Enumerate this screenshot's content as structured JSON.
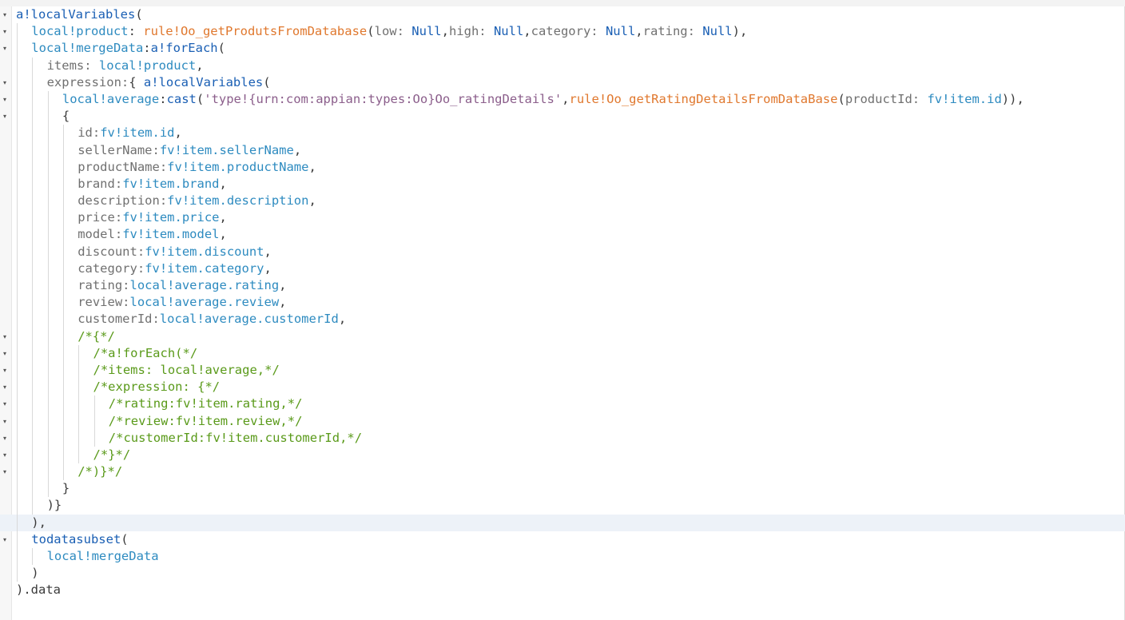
{
  "editor": {
    "highlighted_line": 31,
    "lines": [
      {
        "fold": true,
        "indent": 0,
        "tokens": [
          {
            "t": "a!localVariables",
            "c": "kw"
          },
          {
            "t": "(",
            "c": "plain"
          }
        ]
      },
      {
        "fold": true,
        "indent": 1,
        "tokens": [
          {
            "t": "local!product",
            "c": "var"
          },
          {
            "t": ": ",
            "c": "plain"
          },
          {
            "t": "rule!Oo_getProdutsFromDatabase",
            "c": "rule"
          },
          {
            "t": "(",
            "c": "plain"
          },
          {
            "t": "low: ",
            "c": "param"
          },
          {
            "t": "Null",
            "c": "null"
          },
          {
            "t": ",",
            "c": "plain"
          },
          {
            "t": "high: ",
            "c": "param"
          },
          {
            "t": "Null",
            "c": "null"
          },
          {
            "t": ",",
            "c": "plain"
          },
          {
            "t": "category: ",
            "c": "param"
          },
          {
            "t": "Null",
            "c": "null"
          },
          {
            "t": ",",
            "c": "plain"
          },
          {
            "t": "rating: ",
            "c": "param"
          },
          {
            "t": "Null",
            "c": "null"
          },
          {
            "t": "),",
            "c": "plain"
          }
        ]
      },
      {
        "fold": true,
        "indent": 1,
        "tokens": [
          {
            "t": "local!mergeData",
            "c": "var"
          },
          {
            "t": ":",
            "c": "plain"
          },
          {
            "t": "a!forEach",
            "c": "kw"
          },
          {
            "t": "(",
            "c": "plain"
          }
        ]
      },
      {
        "fold": false,
        "indent": 2,
        "tokens": [
          {
            "t": "items: ",
            "c": "param"
          },
          {
            "t": "local!product",
            "c": "var"
          },
          {
            "t": ",",
            "c": "plain"
          }
        ]
      },
      {
        "fold": true,
        "indent": 2,
        "tokens": [
          {
            "t": "expression:",
            "c": "param"
          },
          {
            "t": "{ ",
            "c": "plain"
          },
          {
            "t": "a!localVariables",
            "c": "kw"
          },
          {
            "t": "(",
            "c": "plain"
          }
        ]
      },
      {
        "fold": true,
        "indent": 3,
        "tokens": [
          {
            "t": "local!average",
            "c": "var"
          },
          {
            "t": ":",
            "c": "plain"
          },
          {
            "t": "cast",
            "c": "kw"
          },
          {
            "t": "(",
            "c": "plain"
          },
          {
            "t": "'type!{urn:com:appian:types:Oo}Oo_ratingDetails'",
            "c": "str"
          },
          {
            "t": ",",
            "c": "plain"
          },
          {
            "t": "rule!Oo_getRatingDetailsFromDataBase",
            "c": "rule"
          },
          {
            "t": "(",
            "c": "plain"
          },
          {
            "t": "productId: ",
            "c": "param"
          },
          {
            "t": "fv!item.id",
            "c": "var"
          },
          {
            "t": ")),",
            "c": "plain"
          }
        ]
      },
      {
        "fold": true,
        "indent": 3,
        "tokens": [
          {
            "t": "{",
            "c": "plain"
          }
        ]
      },
      {
        "fold": false,
        "indent": 4,
        "tokens": [
          {
            "t": "id:",
            "c": "param"
          },
          {
            "t": "fv!item.id",
            "c": "var"
          },
          {
            "t": ",",
            "c": "plain"
          }
        ]
      },
      {
        "fold": false,
        "indent": 4,
        "tokens": [
          {
            "t": "sellerName:",
            "c": "param"
          },
          {
            "t": "fv!item.sellerName",
            "c": "var"
          },
          {
            "t": ",",
            "c": "plain"
          }
        ]
      },
      {
        "fold": false,
        "indent": 4,
        "tokens": [
          {
            "t": "productName:",
            "c": "param"
          },
          {
            "t": "fv!item.productName",
            "c": "var"
          },
          {
            "t": ",",
            "c": "plain"
          }
        ]
      },
      {
        "fold": false,
        "indent": 4,
        "tokens": [
          {
            "t": "brand:",
            "c": "param"
          },
          {
            "t": "fv!item.brand",
            "c": "var"
          },
          {
            "t": ",",
            "c": "plain"
          }
        ]
      },
      {
        "fold": false,
        "indent": 4,
        "tokens": [
          {
            "t": "description:",
            "c": "param"
          },
          {
            "t": "fv!item.description",
            "c": "var"
          },
          {
            "t": ",",
            "c": "plain"
          }
        ]
      },
      {
        "fold": false,
        "indent": 4,
        "tokens": [
          {
            "t": "price:",
            "c": "param"
          },
          {
            "t": "fv!item.price",
            "c": "var"
          },
          {
            "t": ",",
            "c": "plain"
          }
        ]
      },
      {
        "fold": false,
        "indent": 4,
        "tokens": [
          {
            "t": "model:",
            "c": "param"
          },
          {
            "t": "fv!item.model",
            "c": "var"
          },
          {
            "t": ",",
            "c": "plain"
          }
        ]
      },
      {
        "fold": false,
        "indent": 4,
        "tokens": [
          {
            "t": "discount:",
            "c": "param"
          },
          {
            "t": "fv!item.discount",
            "c": "var"
          },
          {
            "t": ",",
            "c": "plain"
          }
        ]
      },
      {
        "fold": false,
        "indent": 4,
        "tokens": [
          {
            "t": "category:",
            "c": "param"
          },
          {
            "t": "fv!item.category",
            "c": "var"
          },
          {
            "t": ",",
            "c": "plain"
          }
        ]
      },
      {
        "fold": false,
        "indent": 4,
        "tokens": [
          {
            "t": "rating:",
            "c": "param"
          },
          {
            "t": "local!average.rating",
            "c": "var"
          },
          {
            "t": ",",
            "c": "plain"
          }
        ]
      },
      {
        "fold": false,
        "indent": 4,
        "tokens": [
          {
            "t": "review:",
            "c": "param"
          },
          {
            "t": "local!average.review",
            "c": "var"
          },
          {
            "t": ",",
            "c": "plain"
          }
        ]
      },
      {
        "fold": false,
        "indent": 4,
        "tokens": [
          {
            "t": "customerId:",
            "c": "param"
          },
          {
            "t": "local!average.customerId",
            "c": "var"
          },
          {
            "t": ",",
            "c": "plain"
          }
        ]
      },
      {
        "fold": true,
        "indent": 4,
        "tokens": [
          {
            "t": "/*{*/",
            "c": "cmt"
          }
        ]
      },
      {
        "fold": true,
        "indent": 5,
        "tokens": [
          {
            "t": "/*a!forEach(*/",
            "c": "cmt"
          }
        ]
      },
      {
        "fold": true,
        "indent": 5,
        "tokens": [
          {
            "t": "/*items: local!average,*/",
            "c": "cmt"
          }
        ]
      },
      {
        "fold": true,
        "indent": 5,
        "tokens": [
          {
            "t": "/*expression: {*/",
            "c": "cmt"
          }
        ]
      },
      {
        "fold": true,
        "indent": 6,
        "tokens": [
          {
            "t": "/*rating:fv!item.rating,*/",
            "c": "cmt"
          }
        ]
      },
      {
        "fold": true,
        "indent": 6,
        "tokens": [
          {
            "t": "/*review:fv!item.review,*/",
            "c": "cmt"
          }
        ]
      },
      {
        "fold": true,
        "indent": 6,
        "tokens": [
          {
            "t": "/*customerId:fv!item.customerId,*/",
            "c": "cmt"
          }
        ]
      },
      {
        "fold": true,
        "indent": 5,
        "tokens": [
          {
            "t": "/*}*/",
            "c": "cmt"
          }
        ]
      },
      {
        "fold": true,
        "indent": 4,
        "tokens": [
          {
            "t": "/*)}*/",
            "c": "cmt"
          }
        ]
      },
      {
        "fold": false,
        "indent": 3,
        "tokens": [
          {
            "t": "}",
            "c": "plain"
          }
        ]
      },
      {
        "fold": false,
        "indent": 2,
        "tokens": [
          {
            "t": ")}",
            "c": "plain"
          }
        ]
      },
      {
        "fold": false,
        "indent": 1,
        "tokens": [
          {
            "t": "),",
            "c": "plain"
          }
        ]
      },
      {
        "fold": true,
        "indent": 1,
        "tokens": [
          {
            "t": "todatasubset",
            "c": "kw"
          },
          {
            "t": "(",
            "c": "plain"
          }
        ]
      },
      {
        "fold": false,
        "indent": 2,
        "tokens": [
          {
            "t": "local!mergeData",
            "c": "var"
          }
        ]
      },
      {
        "fold": false,
        "indent": 1,
        "tokens": [
          {
            "t": ")",
            "c": "plain"
          }
        ]
      },
      {
        "fold": false,
        "indent": 0,
        "tokens": [
          {
            "t": ").data",
            "c": "plain"
          }
        ]
      }
    ]
  }
}
